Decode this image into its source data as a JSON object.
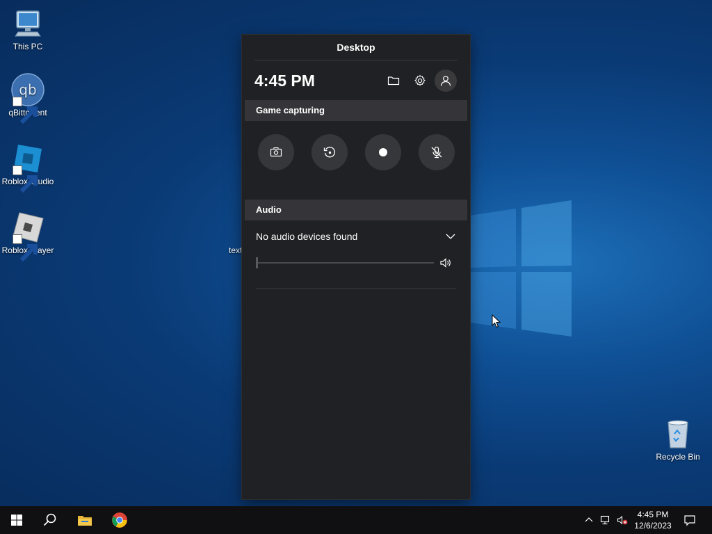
{
  "desktop": {
    "icons": [
      {
        "label": "This PC",
        "icon": "computer-icon"
      },
      {
        "label": "qBittorrent",
        "icon": "qbittorrent-icon",
        "glyph": "qb"
      },
      {
        "label": "Roblox Studio",
        "icon": "roblox-studio-icon"
      },
      {
        "label": "Roblox Player",
        "icon": "roblox-player-icon"
      },
      {
        "label": "text",
        "icon": "text-file-icon"
      },
      {
        "label": "Recycle Bin",
        "icon": "recycle-bin-icon"
      }
    ]
  },
  "gamebar": {
    "title": "Desktop",
    "time": "4:45 PM",
    "top_icons": [
      "folder-icon",
      "gear-icon",
      "user-icon"
    ],
    "capture_section": {
      "title": "Game capturing",
      "buttons": [
        "camera-icon",
        "record-last-icon",
        "record-dot-icon",
        "mic-off-icon"
      ]
    },
    "audio_section": {
      "title": "Audio",
      "device": "No audio devices found",
      "volume_level": 0
    }
  },
  "taskbar": {
    "buttons": [
      "windows-start-icon",
      "search-icon",
      "file-explorer-icon",
      "chrome-icon"
    ],
    "tray": [
      "chevron-up-icon",
      "network-icon",
      "volume-muted-icon"
    ],
    "clock": {
      "time": "4:45 PM",
      "date": "12/6/2023"
    }
  },
  "colors": {
    "panel_bg": "#202124",
    "section_bg": "#353539",
    "button_bg": "#36373a",
    "taskbar_bg": "#101012"
  }
}
